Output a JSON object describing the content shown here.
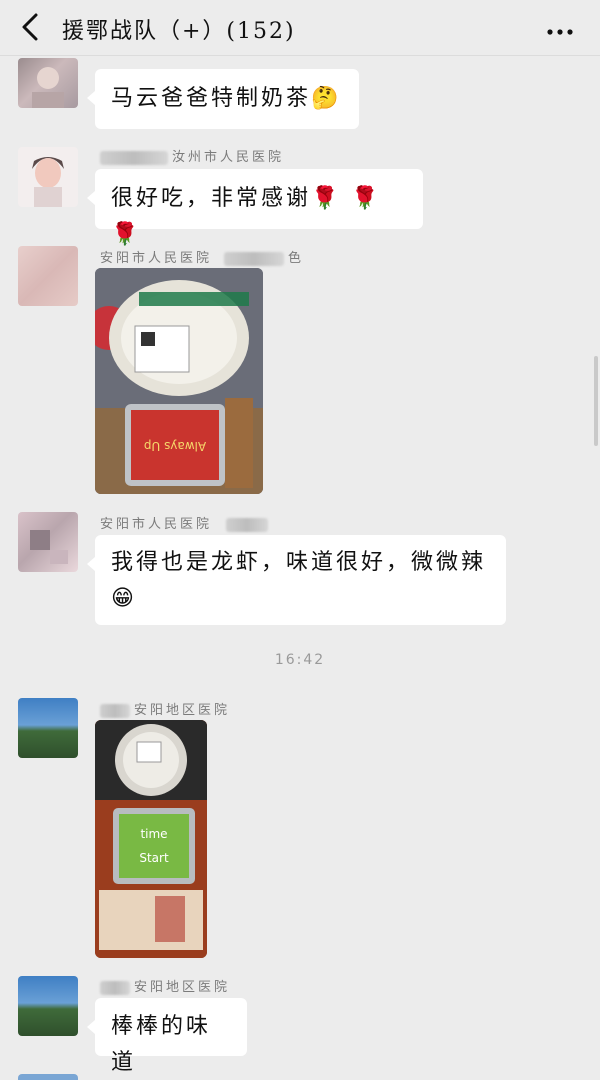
{
  "header": {
    "title": "援鄂战队（+）(152)",
    "back_icon": "chevron-left-icon",
    "more_icon": "more-dots-icon"
  },
  "messages": [
    {
      "type": "text",
      "sender": "",
      "text": "马云爸爸特制奶茶",
      "emoji": "🤔"
    },
    {
      "type": "text",
      "sender": "汝州市人民医院",
      "text": "很好吃，非常感谢",
      "emoji": "🌹 🌹 🌹"
    },
    {
      "type": "image",
      "sender": "安阳市人民医院",
      "sender_suffix": "色",
      "image_desc": "milk-tea-and-crayfish-box-photo"
    },
    {
      "type": "text",
      "sender": "安阳市人民医院",
      "text": "我得也是龙虾，味道很好，微微辣",
      "emoji": "😁"
    },
    {
      "type": "time",
      "text": "16:42"
    },
    {
      "type": "image",
      "sender": "安阳地区医院",
      "image_desc": "milk-tea-and-food-box-photo"
    },
    {
      "type": "text",
      "sender": "安阳地区医院",
      "text": "棒棒的味道",
      "emoji": ""
    }
  ],
  "colors": {
    "background": "#ececec",
    "bubble": "#ffffff",
    "sender_text": "#7b7b7b"
  }
}
